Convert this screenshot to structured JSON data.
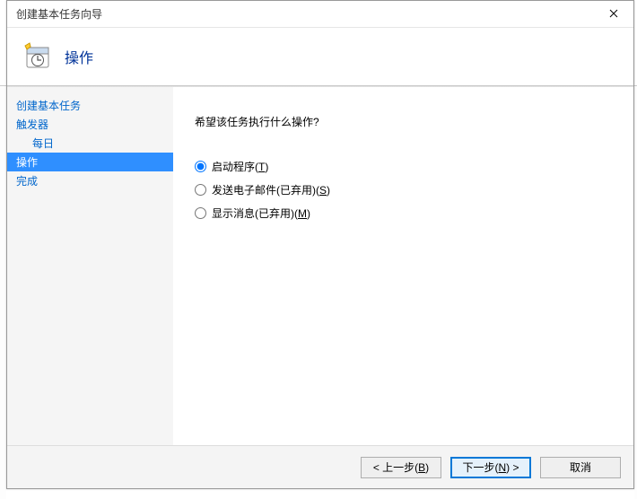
{
  "window": {
    "title": "创建基本任务向导"
  },
  "header": {
    "title": "操作",
    "icon": "scheduler-icon"
  },
  "sidebar": {
    "items": [
      {
        "label": "创建基本任务",
        "level": 0,
        "selected": false
      },
      {
        "label": "触发器",
        "level": 0,
        "selected": false
      },
      {
        "label": "每日",
        "level": 1,
        "selected": false
      },
      {
        "label": "操作",
        "level": 0,
        "selected": true
      },
      {
        "label": "完成",
        "level": 0,
        "selected": false
      }
    ]
  },
  "content": {
    "prompt": "希望该任务执行什么操作?",
    "options": [
      {
        "id": "opt-run",
        "label_pre": "启动程序(",
        "key": "T",
        "label_post": ")",
        "checked": true
      },
      {
        "id": "opt-mail",
        "label_pre": "发送电子邮件(已弃用)(",
        "key": "S",
        "label_post": ")",
        "checked": false
      },
      {
        "id": "opt-msg",
        "label_pre": "显示消息(已弃用)(",
        "key": "M",
        "label_post": ")",
        "checked": false
      }
    ]
  },
  "buttons": {
    "back": {
      "pre": "< 上一步(",
      "key": "B",
      "post": ")"
    },
    "next": {
      "pre": "下一步(",
      "key": "N",
      "post": ") >"
    },
    "cancel": {
      "label": "取消"
    }
  }
}
